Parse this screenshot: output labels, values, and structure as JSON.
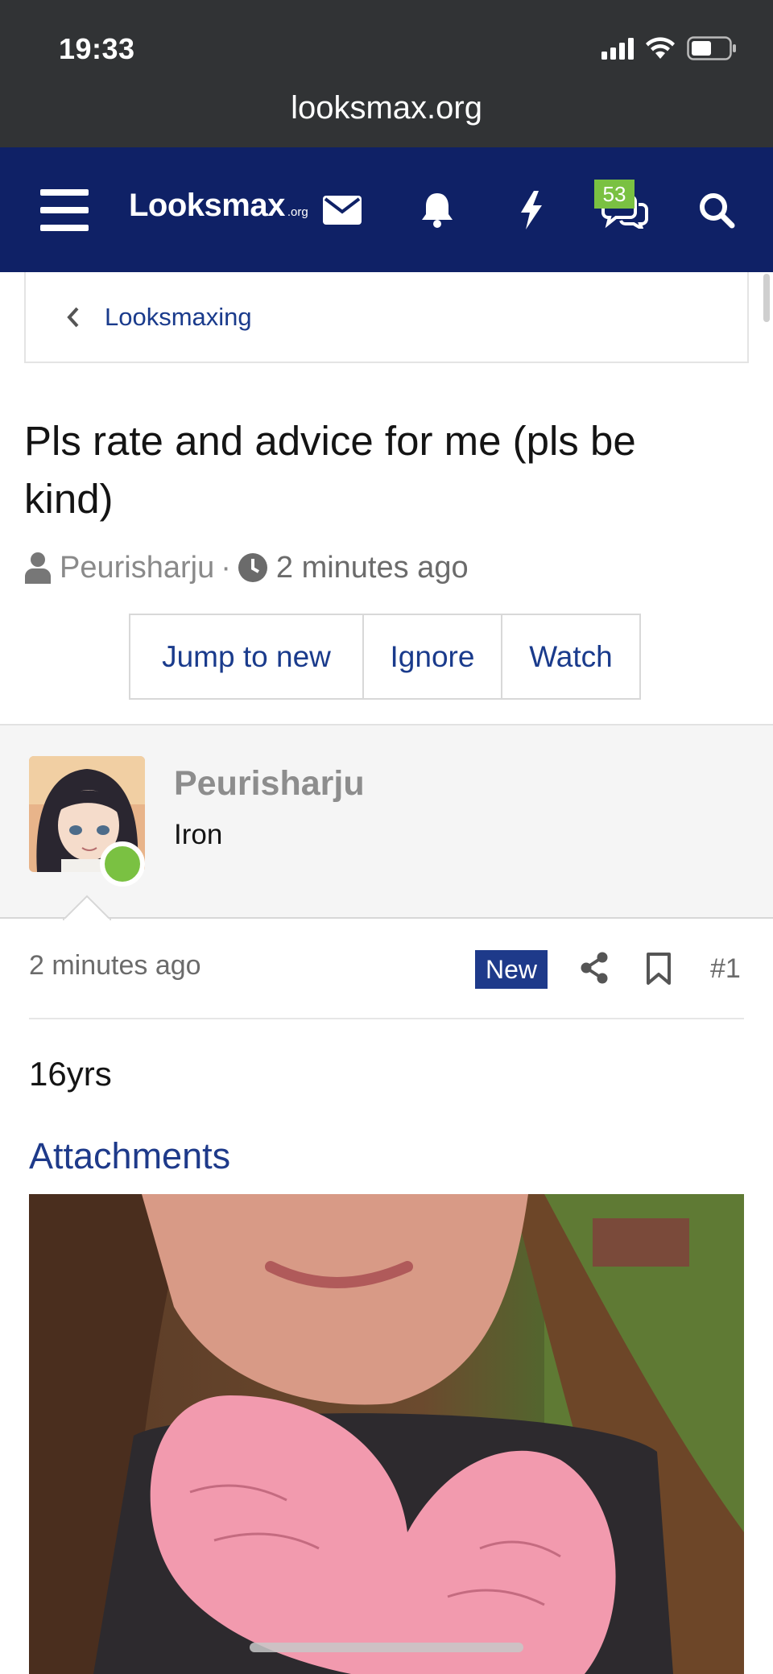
{
  "status_bar": {
    "time": "19:33"
  },
  "browser": {
    "url": "looksmax.org"
  },
  "nav": {
    "logo_main": "Looksmax",
    "logo_sub": ".org",
    "conversations_badge": "53"
  },
  "breadcrumb": {
    "label": "Looksmaxing"
  },
  "thread": {
    "title": "Pls rate and advice for me (pls be kind)",
    "author": "Peurisharju",
    "separator": "·",
    "time": "2 minutes ago",
    "actions": [
      "Jump to new",
      "Ignore",
      "Watch"
    ]
  },
  "post": {
    "username": "Peurisharju",
    "user_title": "Iron",
    "time": "2 minutes ago",
    "new_label": "New",
    "post_number": "#1",
    "body": "16yrs",
    "attachments_heading": "Attachments"
  },
  "colors": {
    "nav_bg": "#0f2166",
    "link": "#1a3b8c",
    "online": "#7ac142",
    "new_badge": "#1e3a8a"
  }
}
